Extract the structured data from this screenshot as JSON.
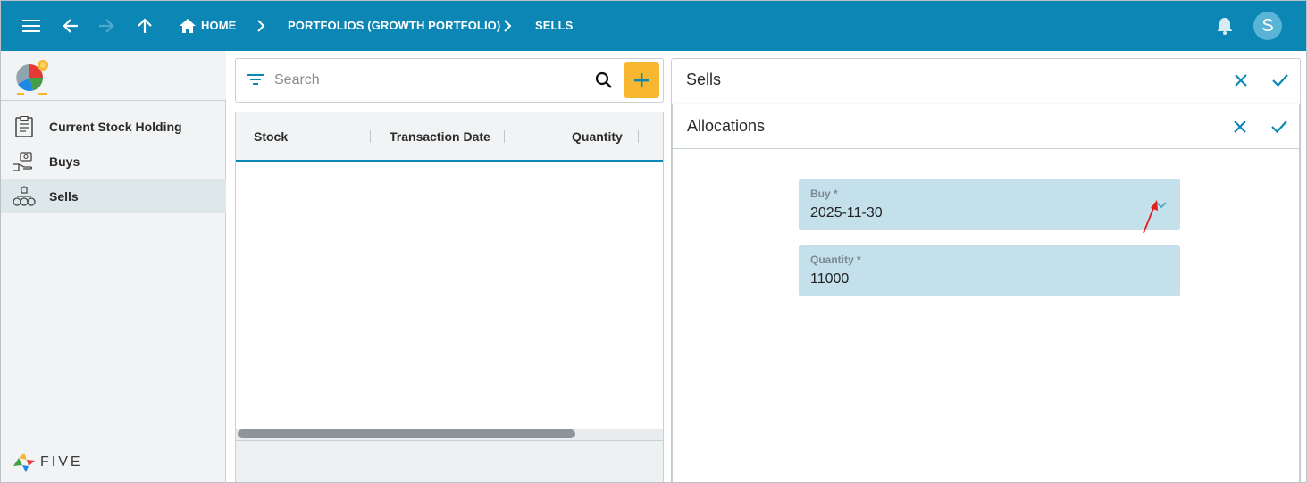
{
  "topbar": {
    "breadcrumbs": [
      "HOME",
      "PORTFOLIOS (GROWTH PORTFOLIO)",
      "SELLS"
    ],
    "user_initial": "S"
  },
  "sidebar": {
    "items": [
      {
        "label": "Current Stock Holding",
        "icon": "clipboard-list-icon",
        "active": false
      },
      {
        "label": "Buys",
        "icon": "hand-money-icon",
        "active": false
      },
      {
        "label": "Sells",
        "icon": "coins-stack-icon",
        "active": true
      }
    ],
    "brand": "FIVE"
  },
  "list": {
    "search_placeholder": "Search",
    "columns": [
      "Stock",
      "Transaction Date",
      "Quantity"
    ],
    "rows": []
  },
  "sells_panel": {
    "title": "Sells"
  },
  "allocations_panel": {
    "title": "Allocations",
    "fields": [
      {
        "label": "Buy *",
        "value": "2025-11-30",
        "type": "select"
      },
      {
        "label": "Quantity *",
        "value": "11000",
        "type": "number"
      }
    ]
  },
  "colors": {
    "primary": "#0c87b5",
    "accent": "#f7b731",
    "field_bg": "#c4e0ea",
    "annotation_arrow": "#e0201b"
  }
}
